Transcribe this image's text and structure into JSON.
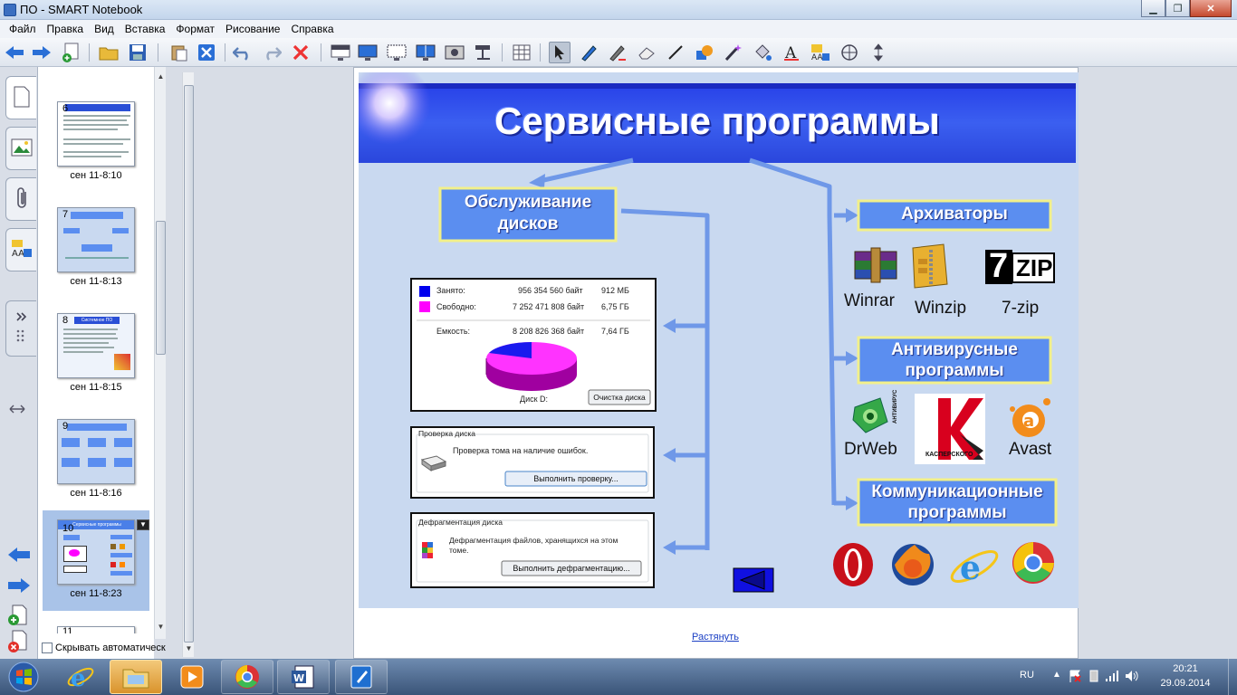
{
  "window": {
    "title": "ПО - SMART Notebook",
    "min_glyph": "▁",
    "max_glyph": "❐",
    "close_glyph": "✕"
  },
  "menu": [
    "Файл",
    "Правка",
    "Вид",
    "Вставка",
    "Формат",
    "Рисование",
    "Справка"
  ],
  "toolbar": {
    "icons": [
      "back-arrow-icon",
      "forward-arrow-icon",
      "add-page-icon",
      "open-folder-icon",
      "save-icon",
      "paste-icon",
      "delete-page-icon",
      "undo-icon",
      "redo-icon",
      "delete-icon",
      "screen-shade-icon",
      "full-screen-icon",
      "transparent-bg-icon",
      "dual-page-icon",
      "screen-capture-icon",
      "document-camera-icon",
      "table-icon",
      "select-icon",
      "pen-icon",
      "creative-pen-icon",
      "eraser-icon",
      "line-icon",
      "shape-icon",
      "magic-pen-icon",
      "fill-icon",
      "text-icon",
      "properties-icon",
      "measurement-icon",
      "move-toolbar-icon"
    ]
  },
  "sidetabs": [
    "page-sorter-icon",
    "gallery-icon",
    "attachments-icon",
    "properties-icon"
  ],
  "pages": [
    {
      "num": "6",
      "label": "сен 11-8:10"
    },
    {
      "num": "7",
      "label": "сен 11-8:13"
    },
    {
      "num": "8",
      "label": "сен 11-8:15"
    },
    {
      "num": "9",
      "label": "сен 11-8:16"
    },
    {
      "num": "10",
      "label": "сен 11-8:23"
    },
    {
      "num": "11",
      "label": ""
    }
  ],
  "thumb8": {
    "title": "Системное ПО"
  },
  "thumb10": {
    "title": "Сервисные программы"
  },
  "autohide": {
    "label": "Скрывать автоматическ"
  },
  "slide": {
    "title": "Сервисные программы",
    "disk_service": {
      "line1": "Обслуживание",
      "line2": "дисков"
    },
    "archivers": "Архиваторы",
    "antivirus": {
      "line1": "Антивирусные",
      "line2": "программы"
    },
    "comm": {
      "line1": "Коммуникационные",
      "line2": "программы"
    },
    "archiver_apps": [
      "Winrar",
      "Winzip",
      "7-zip"
    ],
    "antivirus_apps": [
      "DrWeb",
      "Avast"
    ],
    "kaspersky_logo_text": [
      "АНТИВИРУС",
      "КАСПЕРСКОГО"
    ],
    "zip_logo": {
      "seven": "7",
      "zip": "ZIP"
    },
    "disk_props": {
      "used_label": "Занято:",
      "used_bytes": "956 354 560 байт",
      "used_size": "912 МБ",
      "free_label": "Свободно:",
      "free_bytes": "7 252 471 808 байт",
      "free_size": "6,75 ГБ",
      "cap_label": "Емкость:",
      "cap_bytes": "8 208 826 368 байт",
      "cap_size": "7,64 ГБ",
      "disk_label": "Диск D:",
      "cleanup_btn": "Очистка диска",
      "used_color": "#0000ee",
      "free_color": "#ff00ff"
    },
    "check": {
      "title": "Проверка диска",
      "text": "Проверка тома на наличие ошибок.",
      "btn": "Выполнить проверку..."
    },
    "defrag": {
      "title": "Дефрагментация диска",
      "text1": "Дефрагментация файлов, хранящихся на этом",
      "text2": "томе.",
      "btn": "Выполнить дефрагментацию..."
    }
  },
  "stretch_link": "Растянуть",
  "taskbar": {
    "apps": [
      "ie-icon",
      "explorer-icon",
      "media-player-icon",
      "chrome-icon",
      "word-icon",
      "smart-notebook-icon"
    ],
    "lang": "RU",
    "time": "20:21",
    "date": "29.09.2014"
  },
  "colors": {
    "title_bar": "#2b4be0",
    "box_fill": "#5b8ef0",
    "box_border": "#f2f08a",
    "arrow": "#6f98e8"
  }
}
